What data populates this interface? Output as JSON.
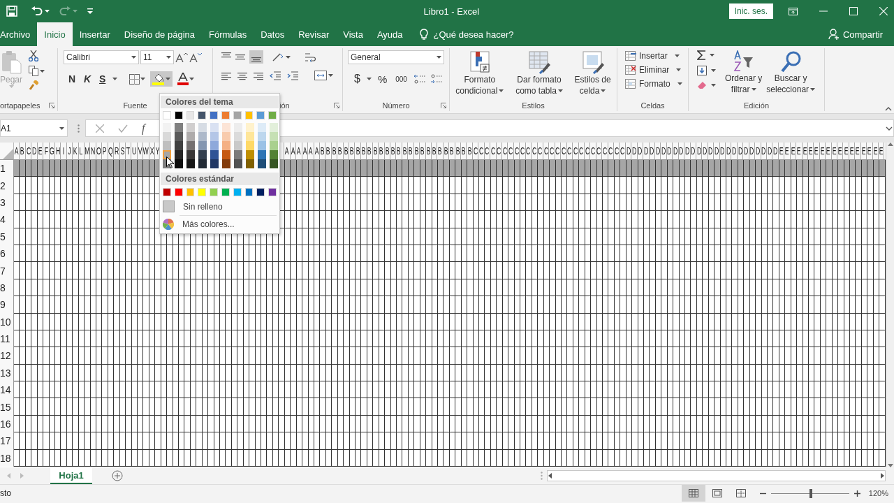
{
  "quick_access": [
    {
      "kind": "save",
      "disabled": false
    },
    {
      "kind": "undo",
      "disabled": false
    },
    {
      "kind": "redo",
      "disabled": true
    },
    {
      "kind": "customize",
      "disabled": false
    }
  ],
  "window": {
    "title": "Libro1  -  Excel",
    "sign_in": "Inic. ses."
  },
  "tabs": [
    {
      "label": "Archivo",
      "selected": false
    },
    {
      "label": "Inicio",
      "selected": true
    },
    {
      "label": "Insertar",
      "selected": false
    },
    {
      "label": "Diseño de página",
      "selected": false
    },
    {
      "label": "Fórmulas",
      "selected": false
    },
    {
      "label": "Datos",
      "selected": false
    },
    {
      "label": "Revisar",
      "selected": false
    },
    {
      "label": "Vista",
      "selected": false
    },
    {
      "label": "Ayuda",
      "selected": false
    }
  ],
  "tell_me": "¿Qué desea hacer?",
  "share": "Compartir",
  "clipboard": {
    "label": "ortapapeles",
    "paste": "Pegar",
    "paste_disabled": true
  },
  "font": {
    "label": "Fuente",
    "name": "Calibri",
    "size": "11",
    "bold": "N",
    "italic": "K",
    "underline": "S",
    "fill_pressed": true
  },
  "alignment": {
    "label": "ión"
  },
  "number": {
    "label": "Número",
    "format": "General",
    "currency": "$",
    "percent": "%",
    "thousands": "000"
  },
  "styles": {
    "label": "Estilos",
    "buttons": [
      {
        "kind": "conditional",
        "line1": "Formato",
        "line2": "condicional"
      },
      {
        "kind": "table",
        "line1": "Dar formato",
        "line2": "como tabla"
      },
      {
        "kind": "cell",
        "line1": "Estilos de",
        "line2": "celda"
      }
    ]
  },
  "cells": {
    "label": "Celdas",
    "items": [
      {
        "kind": "insert",
        "label": "Insertar"
      },
      {
        "kind": "delete",
        "label": "Eliminar"
      },
      {
        "kind": "format",
        "label": "Formato"
      }
    ]
  },
  "editing": {
    "label": "Edición",
    "buttons": [
      {
        "kind": "sort",
        "line1": "Ordenar y",
        "line2": "filtrar"
      },
      {
        "kind": "find",
        "line1": "Buscar y",
        "line2": "seleccionar"
      }
    ]
  },
  "formula_bar": {
    "name_box": "A1",
    "fx": "f"
  },
  "sheet": {
    "column_headers": [
      "A",
      "B",
      "C",
      "D",
      "E",
      "F",
      "G",
      "H",
      "I",
      "J",
      "K",
      "L",
      "M",
      "N",
      "O",
      "P",
      "Q",
      "R",
      "S",
      "T",
      "U",
      "V",
      "W",
      "X",
      "Y"
    ],
    "column_headers_right": [
      "A",
      "A",
      "A",
      "A",
      "A",
      "A",
      "B",
      "B",
      "B",
      "B",
      "B",
      "B",
      "B",
      "B",
      "B",
      "B",
      "B",
      "B",
      "B",
      "B",
      "B",
      "B",
      "B",
      "B",
      "B",
      "B",
      "B",
      "B",
      "B",
      "B",
      "B",
      "B",
      "C",
      "C",
      "C",
      "C",
      "C",
      "C",
      "C",
      "C",
      "C",
      "C",
      "C",
      "C",
      "C",
      "C",
      "C",
      "C",
      "C",
      "C",
      "C",
      "C",
      "C",
      "C",
      "C",
      "C",
      "C",
      "C",
      "D",
      "D",
      "D",
      "D",
      "D",
      "D",
      "D",
      "D",
      "D",
      "D",
      "D",
      "D",
      "D",
      "D",
      "D",
      "D",
      "D",
      "D",
      "D",
      "D",
      "D",
      "D",
      "D",
      "D",
      "D",
      "D",
      "E",
      "E",
      "E",
      "E",
      "E",
      "E",
      "E",
      "E",
      "E",
      "E",
      "E",
      "E",
      "E",
      "E",
      "E",
      "E",
      "E",
      "E"
    ],
    "rows": [
      {
        "header": "1",
        "color": "#a6a6a6"
      },
      {
        "header": "2"
      },
      {
        "header": "3"
      },
      {
        "header": "4"
      },
      {
        "header": "5"
      },
      {
        "header": "6"
      },
      {
        "header": "7"
      },
      {
        "header": "8"
      },
      {
        "header": "9"
      },
      {
        "header": "10"
      },
      {
        "header": "11"
      },
      {
        "header": "12"
      },
      {
        "header": "13"
      },
      {
        "header": "14"
      },
      {
        "header": "15"
      },
      {
        "header": "16"
      },
      {
        "header": "17"
      },
      {
        "header": "18"
      }
    ]
  },
  "fill_menu": {
    "theme_title": "Colores del tema",
    "theme_colors": [
      [
        {
          "color": "#ffffff",
          "selected": false
        },
        {
          "color": "#000000",
          "selected": false
        },
        {
          "color": "#e7e6e6",
          "selected": false
        },
        {
          "color": "#44546a",
          "selected": false
        },
        {
          "color": "#4472c4",
          "selected": false
        },
        {
          "color": "#ed7d31",
          "selected": false
        },
        {
          "color": "#a5a5a5",
          "selected": false
        },
        {
          "color": "#ffc000",
          "selected": false
        },
        {
          "color": "#5b9bd5",
          "selected": false
        },
        {
          "color": "#70ad47",
          "selected": false
        }
      ],
      [
        {
          "color": "#f2f2f2",
          "selected": false
        },
        {
          "color": "#7f7f7f",
          "selected": false
        },
        {
          "color": "#d0cece",
          "selected": false
        },
        {
          "color": "#d6dce4",
          "selected": false
        },
        {
          "color": "#d9e1f2",
          "selected": false
        },
        {
          "color": "#fce4d6",
          "selected": false
        },
        {
          "color": "#ededed",
          "selected": false
        },
        {
          "color": "#fff2cc",
          "selected": false
        },
        {
          "color": "#ddebf7",
          "selected": false
        },
        {
          "color": "#e2efda",
          "selected": false
        }
      ],
      [
        {
          "color": "#d9d9d9",
          "selected": false
        },
        {
          "color": "#595959",
          "selected": false
        },
        {
          "color": "#aeabab",
          "selected": false
        },
        {
          "color": "#adb9ca",
          "selected": false
        },
        {
          "color": "#b4c6e7",
          "selected": false
        },
        {
          "color": "#f8cbad",
          "selected": false
        },
        {
          "color": "#dbdbdb",
          "selected": false
        },
        {
          "color": "#ffe699",
          "selected": false
        },
        {
          "color": "#bdd7ee",
          "selected": false
        },
        {
          "color": "#c6e0b4",
          "selected": false
        }
      ],
      [
        {
          "color": "#bfbfbf",
          "selected": false
        },
        {
          "color": "#404040",
          "selected": false
        },
        {
          "color": "#757171",
          "selected": false
        },
        {
          "color": "#8496b0",
          "selected": false
        },
        {
          "color": "#8ea9db",
          "selected": false
        },
        {
          "color": "#f4b084",
          "selected": false
        },
        {
          "color": "#c9c9c9",
          "selected": false
        },
        {
          "color": "#ffd966",
          "selected": false
        },
        {
          "color": "#9bc2e6",
          "selected": false
        },
        {
          "color": "#a9d08e",
          "selected": false
        }
      ],
      [
        {
          "color": "#a6a6a6",
          "selected": true
        },
        {
          "color": "#262626",
          "selected": false
        },
        {
          "color": "#3a3838",
          "selected": false
        },
        {
          "color": "#333f4f",
          "selected": false
        },
        {
          "color": "#305496",
          "selected": false
        },
        {
          "color": "#c65911",
          "selected": false
        },
        {
          "color": "#7b7b7b",
          "selected": false
        },
        {
          "color": "#bf8f00",
          "selected": false
        },
        {
          "color": "#2f75b5",
          "selected": false
        },
        {
          "color": "#548235",
          "selected": false
        }
      ],
      [
        {
          "color": "#808080",
          "selected": false
        },
        {
          "color": "#0d0d0d",
          "selected": false
        },
        {
          "color": "#161616",
          "selected": false
        },
        {
          "color": "#222a35",
          "selected": false
        },
        {
          "color": "#203764",
          "selected": false
        },
        {
          "color": "#833c0c",
          "selected": false
        },
        {
          "color": "#525252",
          "selected": false
        },
        {
          "color": "#806000",
          "selected": false
        },
        {
          "color": "#1f4e78",
          "selected": false
        },
        {
          "color": "#375623",
          "selected": false
        }
      ]
    ],
    "standard_title": "Colores estándar",
    "standard_colors": [
      {
        "color": "#c00000",
        "selected": false
      },
      {
        "color": "#ff0000",
        "selected": false
      },
      {
        "color": "#ffc000",
        "selected": false
      },
      {
        "color": "#ffff00",
        "selected": false
      },
      {
        "color": "#92d050",
        "selected": false
      },
      {
        "color": "#00b050",
        "selected": false
      },
      {
        "color": "#00b0f0",
        "selected": false
      },
      {
        "color": "#0070c0",
        "selected": false
      },
      {
        "color": "#002060",
        "selected": false
      },
      {
        "color": "#7030a0",
        "selected": false
      }
    ],
    "no_fill": "Sin relleno",
    "more_colors": "Más colores..."
  },
  "sheet_tabs": [
    {
      "label": "Hoja1",
      "selected": true
    }
  ],
  "status_bar": {
    "status": "sto",
    "views": [
      {
        "kind": "normal",
        "selected": true
      },
      {
        "kind": "page_layout",
        "selected": false
      },
      {
        "kind": "page_break",
        "selected": false
      }
    ],
    "zoom": {
      "level": 0.51
    },
    "zoom_text": "120%"
  }
}
